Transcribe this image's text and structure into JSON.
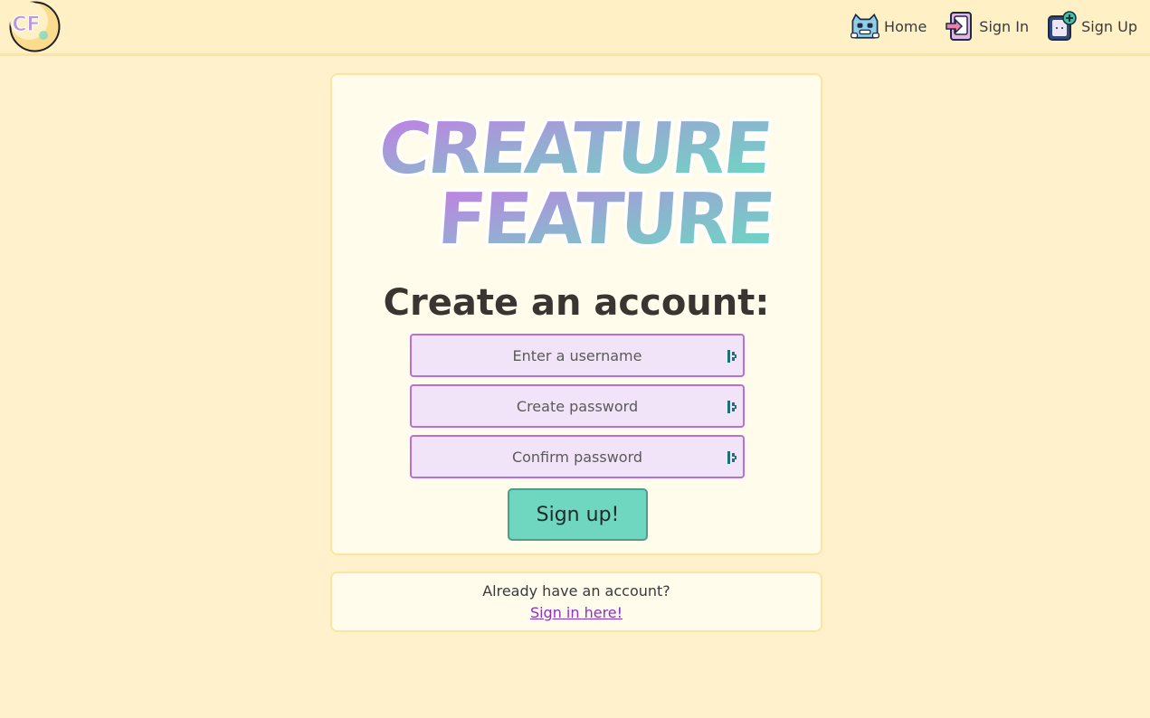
{
  "brand": {
    "logo_text": "CF"
  },
  "nav": {
    "items": [
      {
        "label": "Home",
        "icon": "cat-icon"
      },
      {
        "label": "Sign In",
        "icon": "sign-in-icon"
      },
      {
        "label": "Sign Up",
        "icon": "sign-up-icon"
      }
    ]
  },
  "wordmark": {
    "line1": "CREATURE",
    "line2": "FEATURE"
  },
  "form": {
    "heading": "Create an account:",
    "username_placeholder": "Enter a username",
    "password_placeholder": "Create password",
    "confirm_placeholder": "Confirm password",
    "submit_label": "Sign up!"
  },
  "footer_card": {
    "prompt": "Already have an account?",
    "link_label": "Sign in here!"
  },
  "colors": {
    "page_background": "#fff1cb",
    "card_background": "#fffcec",
    "input_background": "#f2e4f8",
    "input_border": "#b86fdc",
    "button_background": "#6fd6bf",
    "link": "#8e2fc8"
  }
}
